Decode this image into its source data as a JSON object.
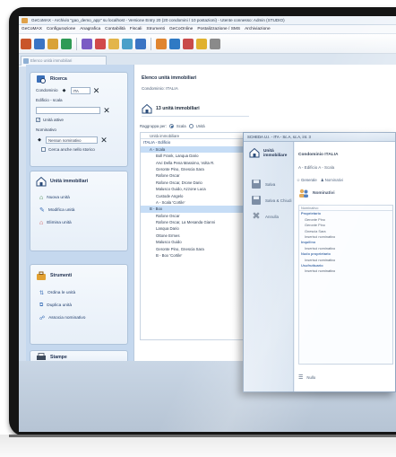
{
  "window": {
    "title": "GeCoMAX - Archivio \"gao_demo_app\" su localhost - Versione Entry 20 (20 condomini / 10 postazioni) - Utente connesso: Admin (STUDIO)"
  },
  "menu": [
    "GeCoMAX",
    "Configurazione",
    "Anagrafica",
    "Contabilità",
    "Fiscali",
    "Strumenti",
    "GeCoOnline",
    "Postalizzazione / SMS",
    "Archiviazione"
  ],
  "toolbar": {
    "icons": [
      "users-icon",
      "building-icon",
      "calculator-icon",
      "chart-icon",
      "receipt-icon",
      "folder-icon",
      "coins-icon",
      "refresh-icon",
      "book-icon",
      "tools-icon",
      "calendar-icon",
      "bell-icon",
      "settings-icon",
      "help-icon"
    ],
    "colors": [
      "#c9562b",
      "#3a74c4",
      "#d9a237",
      "#2f9a55",
      "#7b5cc4",
      "#d14a4a",
      "#e3b54a",
      "#4aa0c9",
      "#3a74c4",
      "#e0852f",
      "#2f7ac4",
      "#c94a4a",
      "#e0b12f",
      "#8a8a8a"
    ]
  },
  "doc_tab": {
    "label": "Elenco unità immobiliari"
  },
  "search_panel": {
    "title": "Ricerca",
    "condominio_label": "Condominio",
    "condominio_value": "ITA",
    "edificio_label": "Edificio - scala",
    "attive_label": "Unità attive",
    "nominativo_label": "Nominativo",
    "nominativo_value": "Nessun nominativo",
    "cerca_label": "Cerca anche nello storico",
    "clear_symbol": "✕"
  },
  "units_panel": {
    "title": "Unità immobiliari",
    "links": [
      "Nuova unità",
      "Modifica unità",
      "Elimina unità"
    ]
  },
  "tools_panel": {
    "title": "Strumenti",
    "links": [
      "Ordina le unità",
      "Duplica unità",
      "Associa nominativo"
    ]
  },
  "print_panel": {
    "title": "Stampe"
  },
  "content": {
    "title": "Elenco unità immobiliari",
    "subtitle": "Condominio: ITALIA",
    "count_label": "13 unità immobiliari",
    "filter_label": "Raggruppa per:",
    "filter_opt1": "Scala",
    "filter_opt2": "Unità",
    "tree": [
      {
        "text": "Unità immobiliare",
        "indent": 1,
        "kind": "head"
      },
      {
        "text": "ITALIA - Edificio",
        "indent": 0,
        "kind": "grp"
      },
      {
        "text": "A - Scala",
        "indent": 1,
        "kind": "sel"
      },
      {
        "text": "Boll Frank, Lanqua Dario",
        "indent": 2
      },
      {
        "text": "Arvi Della Pena Massimo, Volta R.",
        "indent": 2
      },
      {
        "text": "Geronte Pino, Gnescia Sara",
        "indent": 2
      },
      {
        "text": "Rafone Oscar",
        "indent": 2
      },
      {
        "text": "Rafone Oscar, Drone Dario",
        "indent": 2
      },
      {
        "text": "Malusco Guido, Azzone Luca",
        "indent": 2
      },
      {
        "text": "Custode Angelo",
        "indent": 2
      },
      {
        "text": "A - Scala 'Cortile'",
        "indent": 2
      },
      {
        "text": "B - Box",
        "indent": 1,
        "kind": "sel"
      },
      {
        "text": "Rafone Oscar",
        "indent": 2
      },
      {
        "text": "Rafone Oscar, La Mesanda Gianni",
        "indent": 2
      },
      {
        "text": "Lanqua Dario",
        "indent": 2
      },
      {
        "text": "Ottone Ermes",
        "indent": 2
      },
      {
        "text": "Malusco Guido",
        "indent": 2
      },
      {
        "text": "Geronte Pino, Gnescia Sara",
        "indent": 2
      },
      {
        "text": "B - Box 'Cortile'",
        "indent": 2
      }
    ]
  },
  "modal": {
    "title": "SCHEDA U.I. - ITA - Sc.A, sc.A, int. 3",
    "header": "Unità immobiliare",
    "buttons": [
      "Salva",
      "Salva & Chiudi",
      "Annulla"
    ],
    "condominio": "Condominio ITALIA",
    "edificio": "A - Edificio  A - Scala",
    "tab1": "Generale",
    "tab2": "Nominativi",
    "section": "Nominativi",
    "rows": [
      {
        "text": "Nominativo",
        "kind": "head"
      },
      {
        "text": "Proprietario",
        "kind": "sub"
      },
      {
        "text": "Geronte Pino"
      },
      {
        "text": "Geronte Pino"
      },
      {
        "text": "Gnescia Sara"
      },
      {
        "text": "Inserisci nominativo"
      },
      {
        "text": "Inquilino",
        "kind": "sub"
      },
      {
        "text": "Inserisci nominativo"
      },
      {
        "text": "Nudo proprietario",
        "kind": "sub"
      },
      {
        "text": "Inserisci nominativo"
      },
      {
        "text": "Usufruttuario",
        "kind": "sub"
      },
      {
        "text": "Inserisci nominativo"
      }
    ],
    "footer": "Nullo"
  }
}
